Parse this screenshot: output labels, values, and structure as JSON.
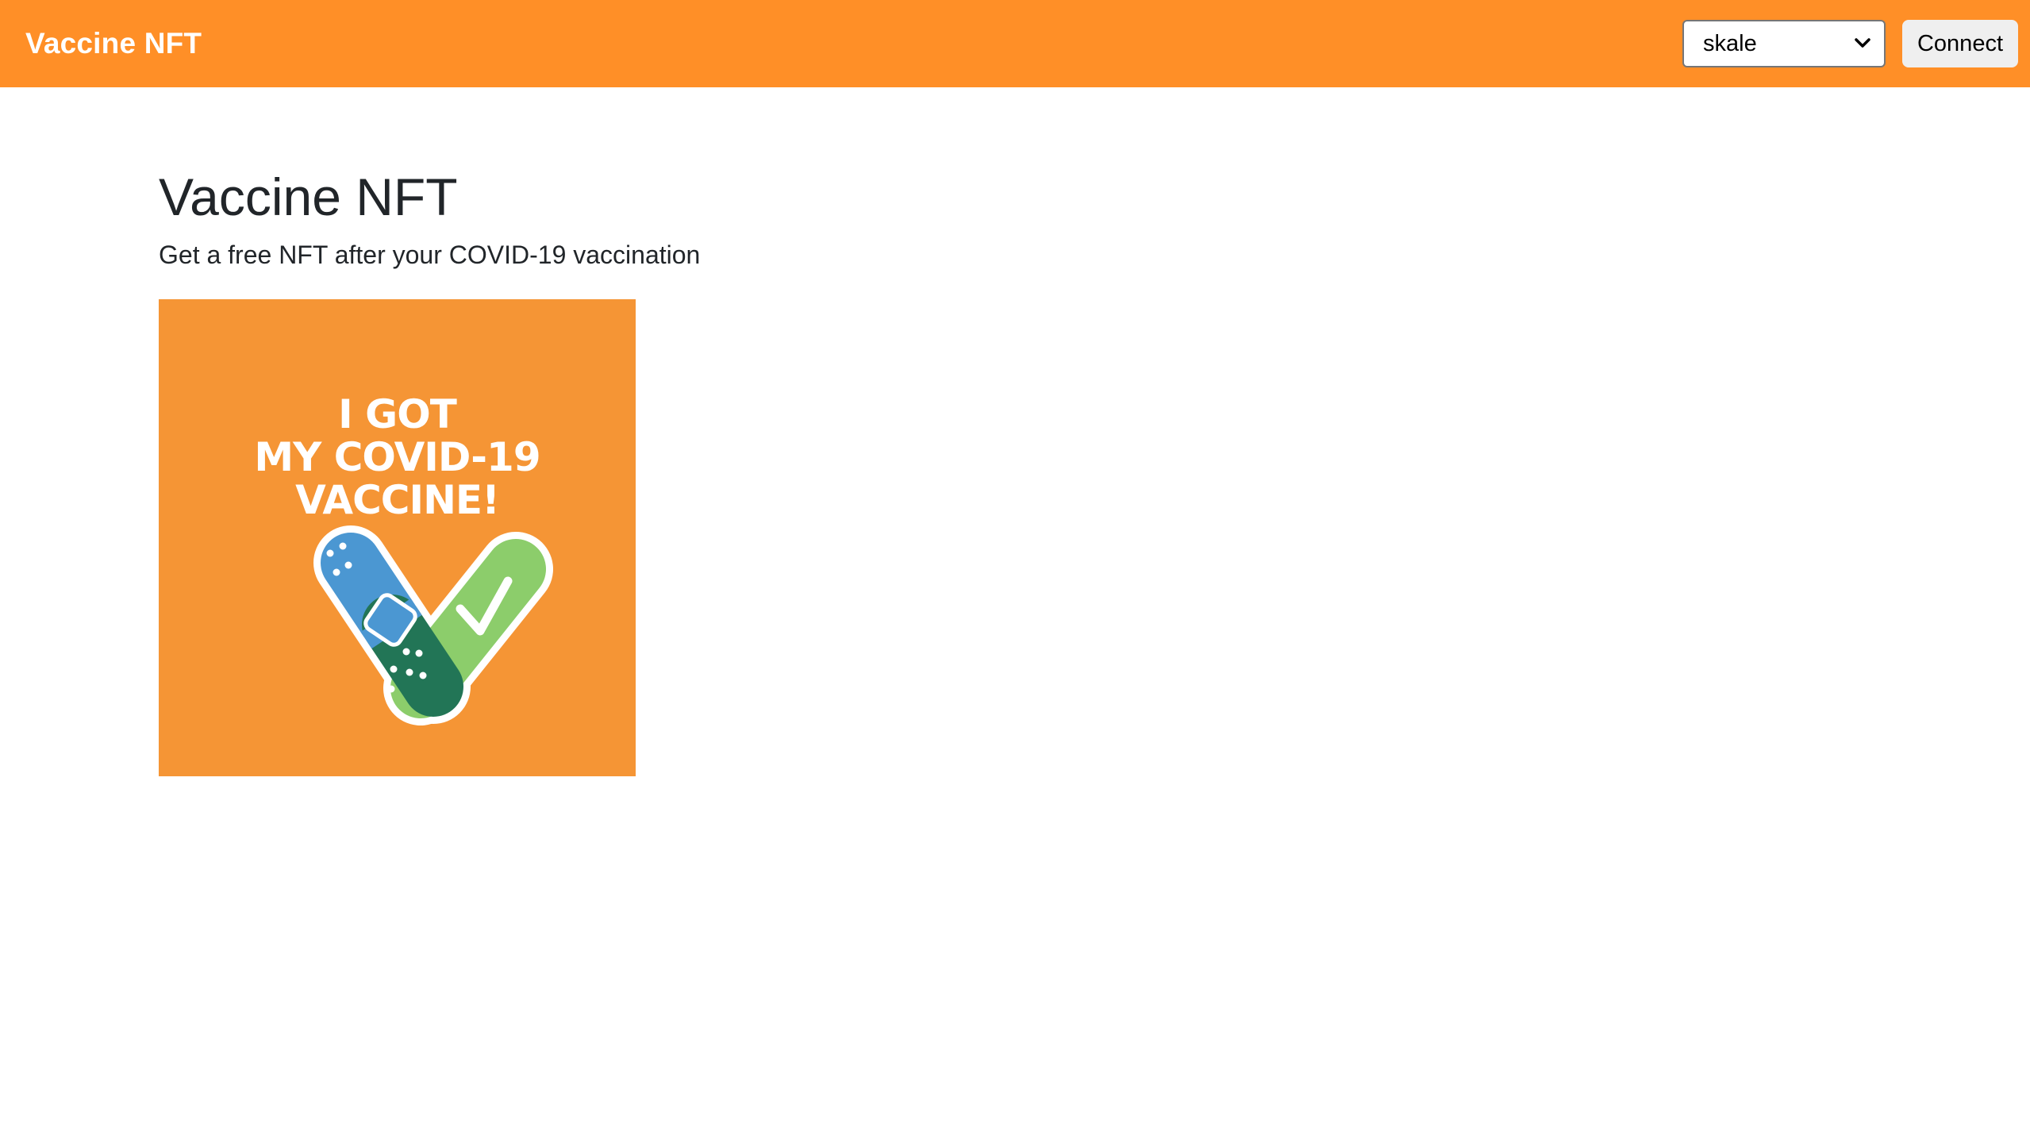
{
  "header": {
    "brand": "Vaccine NFT",
    "network_select": {
      "selected": "skale"
    },
    "connect_label": "Connect"
  },
  "main": {
    "title": "Vaccine NFT",
    "subtitle": "Get a free NFT after your COVID-19 vaccination",
    "nft_image": {
      "lines": [
        "I GOT",
        "MY COVID-19",
        "VACCINE!"
      ]
    }
  },
  "colors": {
    "navbar": "#ff8f27",
    "nft_background": "#f59535",
    "bandage_blue": "#4b97d2",
    "bandage_dark_green": "#227556",
    "checkmark_green": "#8ccd6b"
  }
}
